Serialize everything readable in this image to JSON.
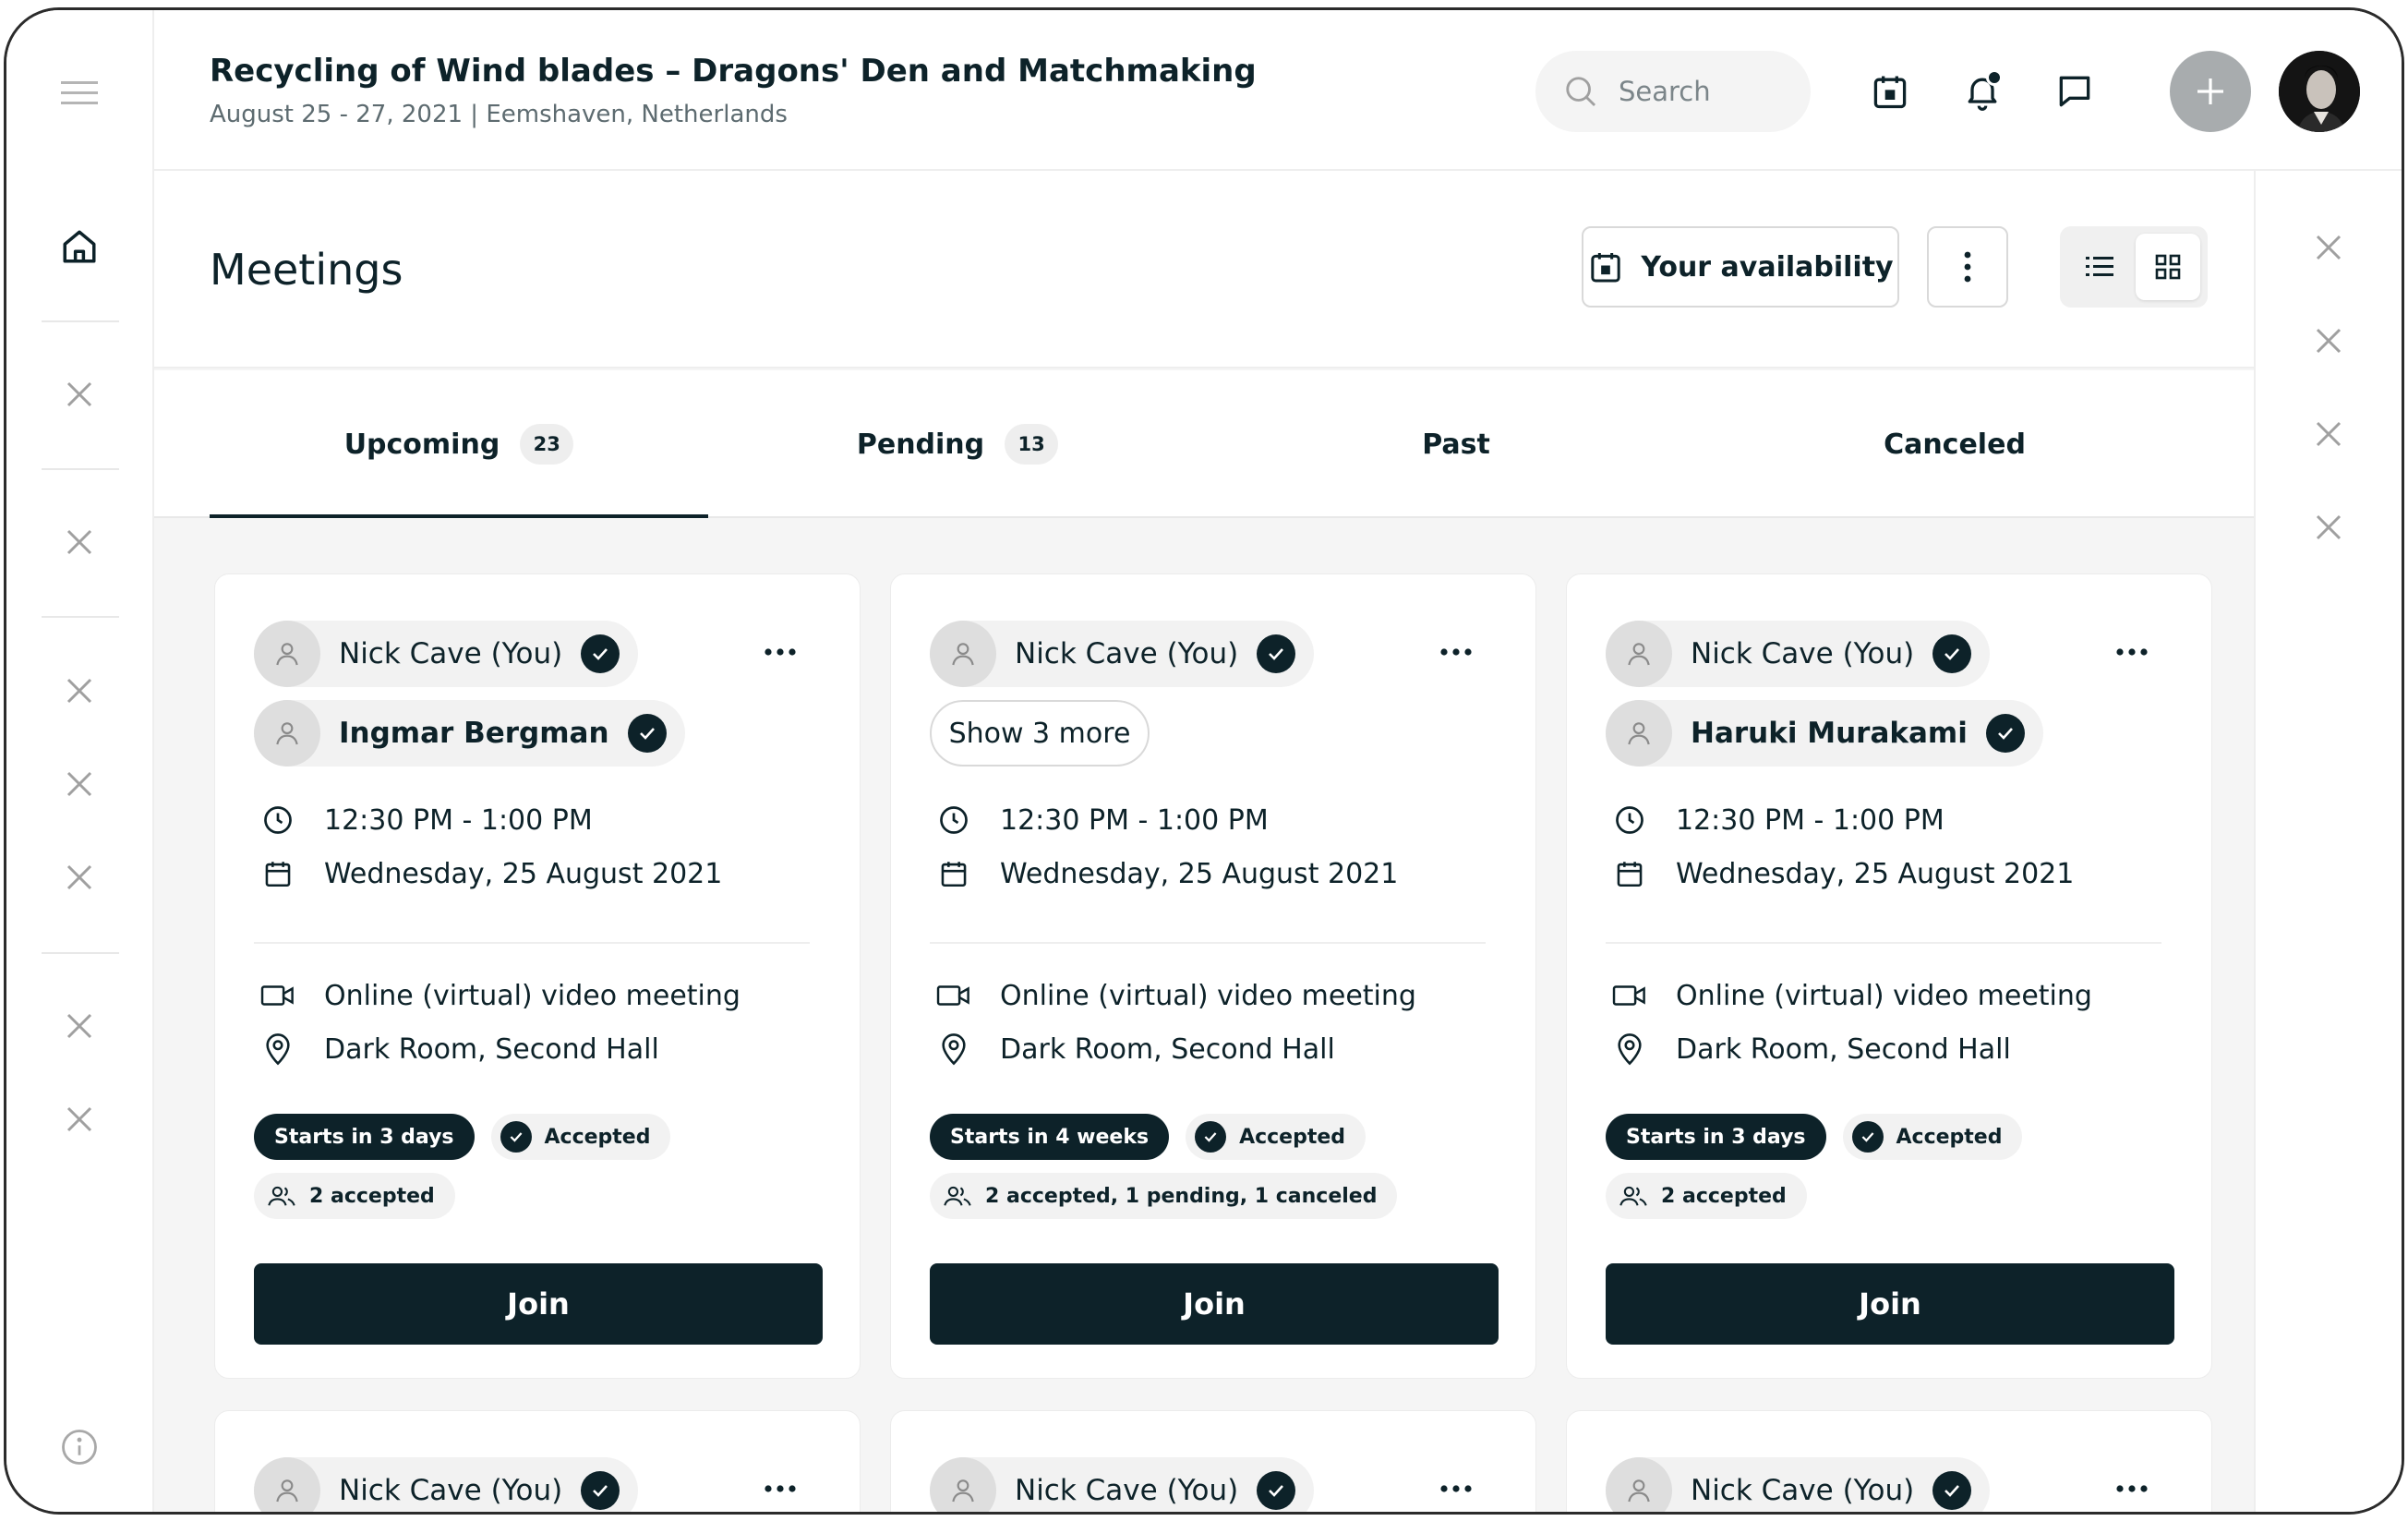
{
  "event": {
    "title": "Recycling of Wind blades – Dragons' Den and Matchmaking",
    "subtitle": "August 25 - 27, 2021  |  Eemshaven, Netherlands"
  },
  "header": {
    "search_placeholder": "Search",
    "icons": [
      "calendar-icon",
      "bell-icon",
      "chat-icon",
      "plus-icon"
    ]
  },
  "page": {
    "title": "Meetings",
    "availability_label": "Your availability",
    "view_modes": [
      "list",
      "grid"
    ],
    "active_view": "grid"
  },
  "tabs": [
    {
      "label": "Upcoming",
      "count": "23",
      "active": true
    },
    {
      "label": "Pending",
      "count": "13",
      "active": false
    },
    {
      "label": "Past",
      "count": "",
      "active": false
    },
    {
      "label": "Canceled",
      "count": "",
      "active": false
    }
  ],
  "cards": [
    {
      "participants": [
        "Nick Cave (You)",
        "Ingmar Bergman"
      ],
      "show_more": "",
      "time": "12:30 PM - 1:00 PM",
      "date": "Wednesday, 25 August 2021",
      "meeting_type": "Online (virtual) video meeting",
      "location": "Dark Room, Second Hall",
      "starts": "Starts in 3 days",
      "status": "Accepted",
      "attendance": "2 accepted",
      "join_label": "Join"
    },
    {
      "participants": [
        "Nick Cave (You)"
      ],
      "show_more": "Show 3 more",
      "time": "12:30 PM - 1:00 PM",
      "date": "Wednesday, 25 August 2021",
      "meeting_type": "Online (virtual) video meeting",
      "location": "Dark Room, Second Hall",
      "starts": "Starts in 4 weeks",
      "status": "Accepted",
      "attendance": "2 accepted, 1 pending, 1 canceled",
      "join_label": "Join"
    },
    {
      "participants": [
        "Nick Cave (You)",
        "Haruki Murakami"
      ],
      "show_more": "",
      "time": "12:30 PM - 1:00 PM",
      "date": "Wednesday, 25 August 2021",
      "meeting_type": "Online (virtual) video meeting",
      "location": "Dark Room, Second Hall",
      "starts": "Starts in 3 days",
      "status": "Accepted",
      "attendance": "2 accepted",
      "join_label": "Join"
    }
  ],
  "next_row_cards": [
    {
      "participant": "Nick Cave (You)"
    },
    {
      "participant": "Nick Cave (You)"
    },
    {
      "participant": "Nick Cave (You)"
    }
  ],
  "colors": {
    "primary": "#0d2229",
    "muted_bg": "#f2f2f2",
    "page_bg": "#f5f5f5"
  }
}
